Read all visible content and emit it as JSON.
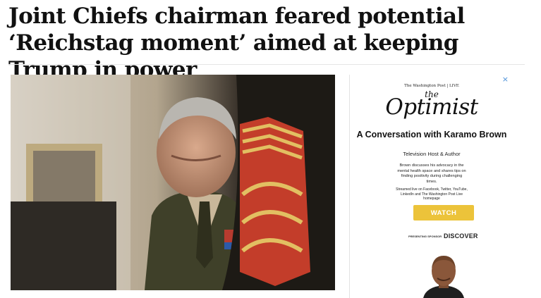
{
  "article": {
    "headline": "Joint Chiefs chairman feared potential ‘Reichstag moment’ aimed at keeping Trump in power"
  },
  "ad": {
    "close_glyph": "×",
    "publisher": "The Washington Post | LIVE",
    "brand_prefix": "the",
    "brand_name": "Optimist",
    "title": "A Conversation with Karamo Brown",
    "role": "Television Host & Author",
    "description": "Brown discusses his advocacy in the mental health space and shares tips on finding positivity during challenging times.",
    "streaming_note": "Streamed live on Facebook, Twitter, YouTube, LinkedIn and The Washington Post Live homepage",
    "cta_label": "WATCH",
    "sponsor_label": "PRESENTING SPONSOR",
    "sponsor_name": "DISCOVER",
    "accent_color": "#ecc33a",
    "sponsor_dot_color": "#e8701a"
  }
}
